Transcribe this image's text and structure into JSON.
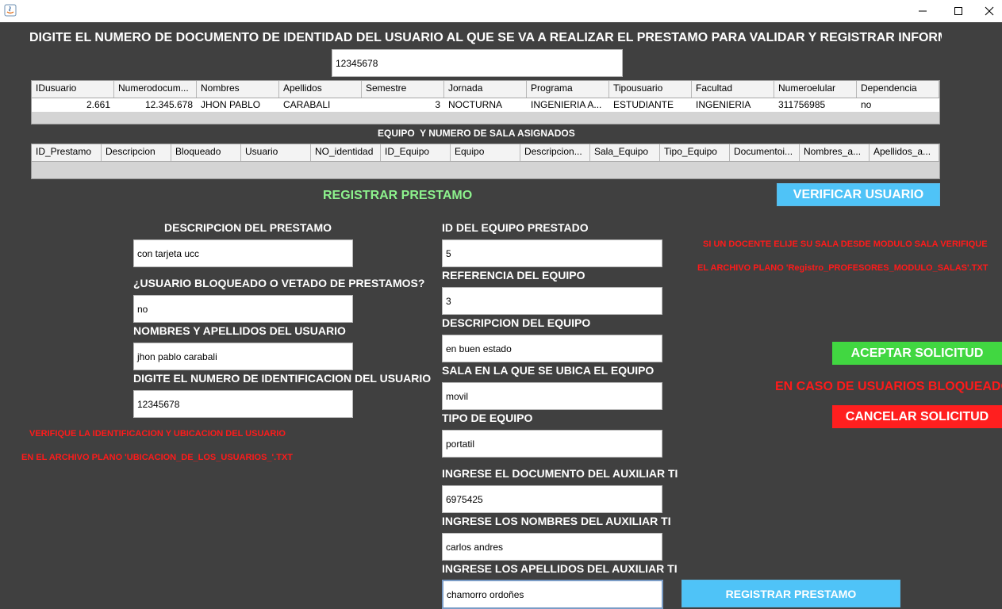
{
  "window": {
    "icon": "java-icon"
  },
  "header_instruction": "DIGITE EL NUMERO DE DOCUMENTO DE IDENTIDAD DEL USUARIO AL QUE SE VA A REALIZAR EL PRESTAMO PARA VALIDAR Y REGISTRAR INFORMACI...",
  "document_search_value": "12345678",
  "users_table": {
    "columns": [
      "IDusuario",
      "Numerodocum...",
      "Nombres",
      "Apellidos",
      "Semestre",
      "Jornada",
      "Programa",
      "Tipousuario",
      "Facultad",
      "Numeroelular",
      "Dependencia"
    ],
    "rows": [
      [
        "2.661",
        "12.345.678",
        "JHON PABLO",
        "CARABALI",
        "3",
        "NOCTURNA",
        "INGENIERIA A...",
        "ESTUDIANTE",
        "INGENIERIA",
        "311756985",
        "no"
      ]
    ]
  },
  "equipment_section_title": "EQUIPO  Y NUMERO DE SALA ASIGNADOS",
  "loans_table": {
    "columns": [
      "ID_Prestamo",
      "Descripcion",
      "Bloqueado",
      "Usuario",
      "NO_identidad",
      "ID_Equipo",
      "Equipo",
      "Descripcion...",
      "Sala_Equipo",
      "Tipo_Equipo",
      "Documentoi...",
      "Nombres_a...",
      "Apellidos_a..."
    ]
  },
  "register_title": "REGISTRAR PRESTAMO",
  "verify_button": "VERIFICAR USUARIO",
  "left_form": {
    "description_label": "DESCRIPCION DEL PRESTAMO",
    "description_value": "con tarjeta ucc",
    "blocked_label": "¿USUARIO BLOQUEADO O VETADO DE PRESTAMOS?",
    "blocked_value": "no",
    "names_label": "NOMBRES Y APELLIDOS DEL USUARIO",
    "names_value": "jhon pablo carabali",
    "id_label": "DIGITE EL NUMERO DE  IDENTIFICACION DEL USUARIO",
    "id_value": "12345678"
  },
  "left_warning": {
    "line1": "VERIFIQUE LA IDENTIFICACION Y UBICACION DEL USUARIO",
    "line2": "EN EL ARCHIVO PLANO 'UBICACION_DE_LOS_USUARIOS_'.TXT"
  },
  "right_form": {
    "equipment_id_label": "ID DEL EQUIPO PRESTADO",
    "equipment_id_value": "5",
    "reference_label": "REFERENCIA DEL EQUIPO",
    "reference_value": "3",
    "equip_description_label": "DESCRIPCION DEL EQUIPO",
    "equip_description_value": "en buen estado",
    "room_label": "SALA EN LA QUE SE UBICA EL EQUIPO",
    "room_value": "movil",
    "type_label": "TIPO DE EQUIPO",
    "type_value": "portatil",
    "aux_doc_label": "INGRESE EL DOCUMENTO DEL AUXILIAR TI",
    "aux_doc_value": "6975425",
    "aux_names_label": "INGRESE LOS NOMBRES DEL AUXILIAR TI",
    "aux_names_value": "carlos andres",
    "aux_lastnames_label": "INGRESE LOS APELLIDOS DEL AUXILIAR TI",
    "aux_lastnames_value": "chamorro ordoñes"
  },
  "register_button": "REGISTRAR PRESTAMO",
  "right_warning": {
    "line1": "SI UN DOCENTE ELIJE SU SALA DESDE MODULO SALA VERIFIQUE",
    "line2": "EL ARCHIVO PLANO 'Registro_PROFESORES_MODULO_SALAS'.TXT"
  },
  "accept_button": "ACEPTAR SOLICITUD",
  "blocked_users_note": "EN CASO DE USUARIOS BLOQUEADOS",
  "cancel_button": "CANCELAR SOLICITUD",
  "colors": {
    "background": "#404040",
    "accent_blue": "#4fc3f7",
    "accept_green": "#41d741",
    "cancel_red": "#ff1f1f",
    "title_green": "#8df28d",
    "warning_red": "#ff1a1a"
  }
}
